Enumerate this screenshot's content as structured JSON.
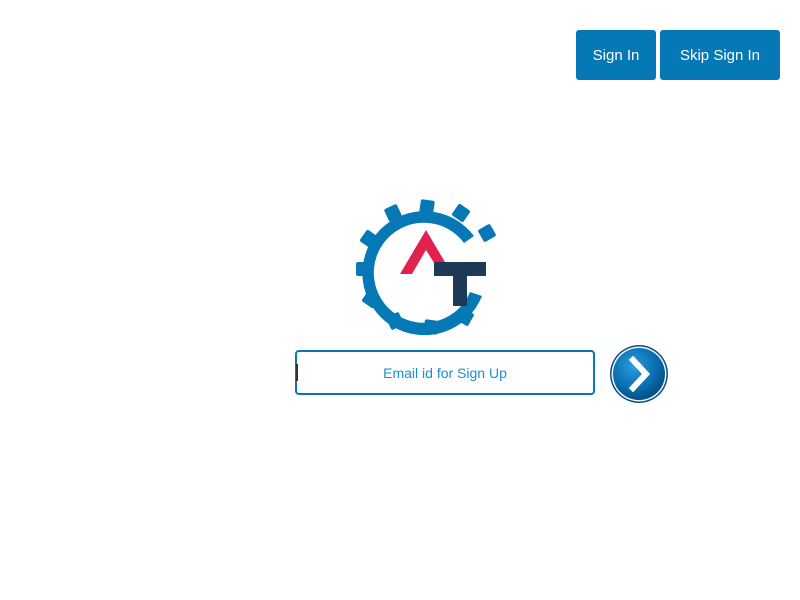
{
  "header": {
    "sign_in_label": "Sign In",
    "skip_sign_in_label": "Skip Sign In"
  },
  "logo": {
    "icon": "gear-at-logo-icon",
    "colors": {
      "gear": "#0778b6",
      "a_shape": "#e0234e",
      "t_shape": "#1f3a57"
    }
  },
  "signup": {
    "email_placeholder": "Email id for Sign Up",
    "email_value": "",
    "submit_icon": "chevron-right-icon"
  },
  "colors": {
    "primary": "#0778b6",
    "button_text": "#ffffff",
    "placeholder_text": "#1a8fd0",
    "background": "#ffffff"
  }
}
